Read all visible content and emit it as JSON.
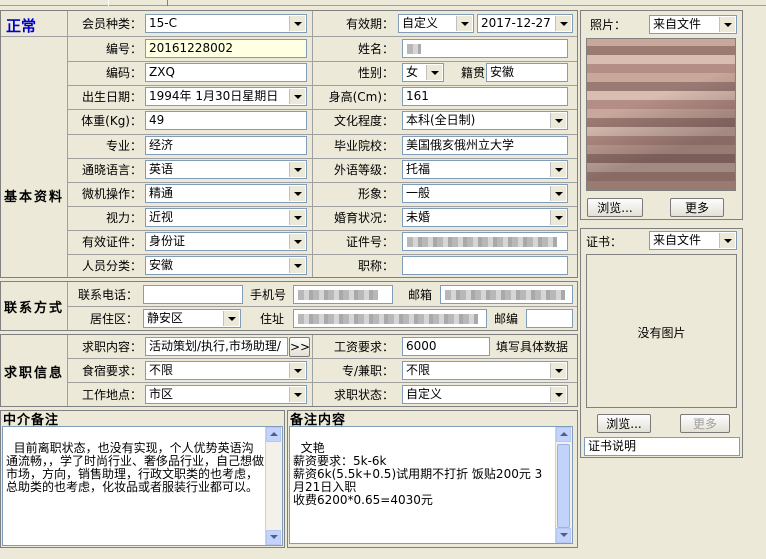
{
  "status": "正常",
  "sections": {
    "basic": "基本资料",
    "contact": "联系方式",
    "job": "求职信息",
    "intermediary": "中介备注",
    "remark": "备注内容"
  },
  "basic": {
    "member_type_label": "会员种类：",
    "member_type": "15-C",
    "validity_label": "有效期：",
    "validity_mode": "自定义",
    "validity_date": "2017-12-27",
    "number_label": "编号：",
    "number": "20161228002",
    "name_label": "姓名：",
    "code_label": "编码：",
    "code": "ZXQ",
    "gender_label": "性别：",
    "gender": "女",
    "native_label": "籍贯",
    "native": "安徽",
    "birth_label": "出生日期：",
    "birth": "1994年 1月30日星期日",
    "height_label": "身高(Cm)：",
    "height": "161",
    "weight_label": "体重(Kg)：",
    "weight": "49",
    "education_label": "文化程度：",
    "education": "本科(全日制)",
    "major_label": "专业：",
    "major": "经济",
    "school_label": "毕业院校：",
    "school": "美国俄亥俄州立大学",
    "language_label": "通晓语言：",
    "language": "英语",
    "foreign_level_label": "外语等级：",
    "foreign_level": "托福",
    "computer_label": "微机操作：",
    "computer": "精通",
    "image_label": "形象：",
    "image": "一般",
    "vision_label": "视力：",
    "vision": "近视",
    "marriage_label": "婚育状况：",
    "marriage": "未婚",
    "id_type_label": "有效证件：",
    "id_type": "身份证",
    "id_no_label": "证件号：",
    "category_label": "人员分类：",
    "category": "安徽",
    "title_label": "职称："
  },
  "contact": {
    "phone_label": "联系电话：",
    "phone": "",
    "mobile_label": "手机号",
    "email_label": "邮箱",
    "district_label": "居住区：",
    "district": "静安区",
    "address_label": "住址",
    "zip_label": "邮编",
    "zip": ""
  },
  "job": {
    "target_label": "求职内容：",
    "target": "活动策划/执行,市场助理/",
    "more_btn": ">>",
    "salary_label": "工资要求：",
    "salary": "6000",
    "salary_note": "填写具体数据",
    "board_label": "食宿要求：",
    "board": "不限",
    "fulltime_label": "专/兼职：",
    "fulltime": "不限",
    "location_label": "工作地点：",
    "location": "市区",
    "status_label": "求职状态：",
    "status": "自定义"
  },
  "notes": {
    "intermediary_text": "目前离职状态，也没有实现，个人优势英语沟通流畅，，学了时尚行业、奢侈品行业，自己想做市场，方向，销售助理，行政文职类的也考虑，总助类的也考虑，化妆品或者服装行业都可以。",
    "remark_text": "文艳\n薪资要求：5k-6k\n薪资6k(5.5k+0.5)试用期不打折 饭贴200元 3月21日入职\n收费6200*0.65=4030元"
  },
  "photo": {
    "label": "照片：",
    "source": "来自文件",
    "browse_btn": "浏览...",
    "more_btn": "更多"
  },
  "certificate": {
    "label": "证书：",
    "source": "来自文件",
    "empty_text": "没有图片",
    "browse_btn": "浏览...",
    "more_btn": "更多",
    "desc": "证书说明"
  },
  "colors": {
    "status_blue": "#0000cc",
    "background": "#ece9d8",
    "field_border": "#7f9db9"
  }
}
